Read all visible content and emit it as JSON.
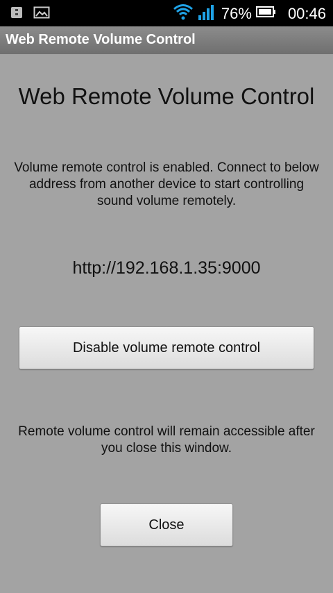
{
  "status_bar": {
    "battery_percent": "76%",
    "time": "00:46",
    "icons": [
      "sim-card-icon",
      "image-notification-icon",
      "wifi-icon",
      "signal-icon",
      "battery-icon"
    ]
  },
  "title_bar": {
    "title": "Web Remote Volume Control"
  },
  "main": {
    "heading": "Web Remote Volume Control",
    "description": "Volume remote control is enabled. Connect to below address from another device to start controlling sound volume remotely.",
    "address": "http://192.168.1.35:9000",
    "disable_button_label": "Disable volume remote control",
    "note": "Remote volume control will remain accessible after you close this window.",
    "close_button_label": "Close"
  }
}
